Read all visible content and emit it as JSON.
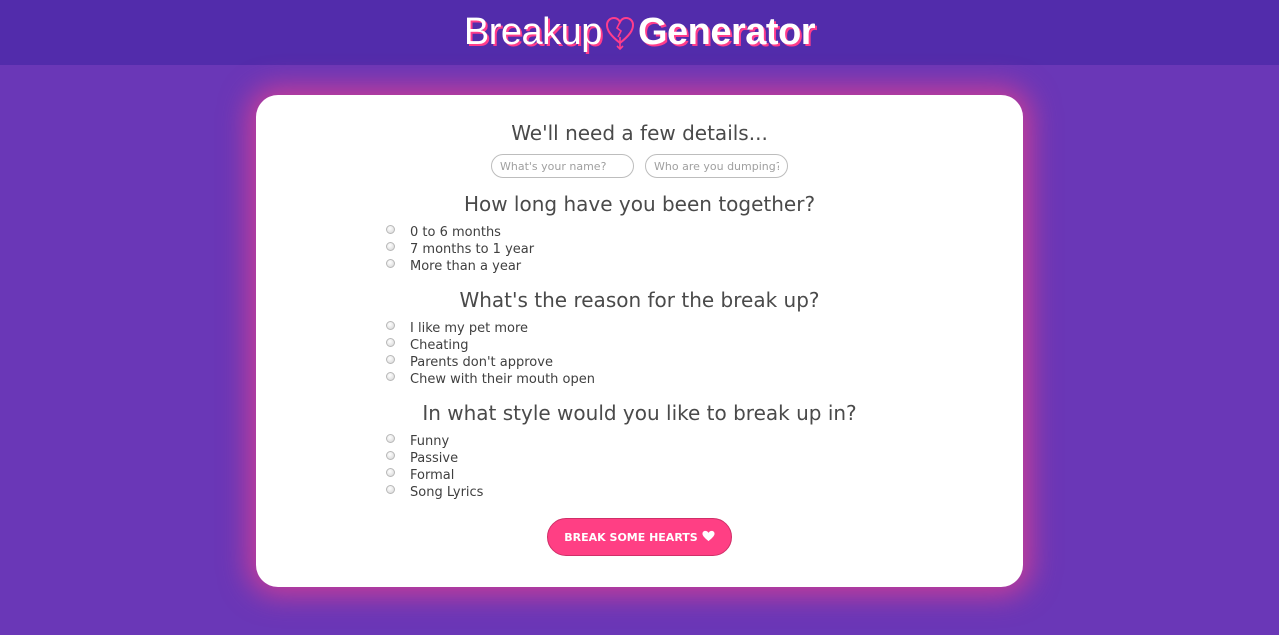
{
  "header": {
    "logo_part1": "Breakup",
    "logo_part2": "Generator",
    "heart_icon": "heart-with-arrow-icon"
  },
  "details": {
    "heading": "We'll need a few details...",
    "name_placeholder": "What's your name?",
    "dumping_placeholder": "Who are you dumping?"
  },
  "duration": {
    "heading": "How long have you been together?",
    "options": [
      "0 to 6 months",
      "7 months to 1 year",
      "More than a year"
    ]
  },
  "reason": {
    "heading": "What's the reason for the break up?",
    "options": [
      "I like my pet more",
      "Cheating",
      "Parents don't approve",
      "Chew with their mouth open"
    ]
  },
  "style": {
    "heading": "In what style would you like to break up in?",
    "options": [
      "Funny",
      "Passive",
      "Formal",
      "Song Lyrics"
    ]
  },
  "submit": {
    "label": "BREAK SOME HEARTS",
    "icon": "heart-icon"
  },
  "colors": {
    "background": "#6a37b7",
    "header_bar": "#522cab",
    "accent_pink": "#ff3f84",
    "card": "#ffffff",
    "text": "#4a4a4a"
  }
}
